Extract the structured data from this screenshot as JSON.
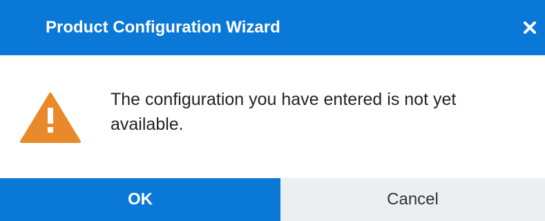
{
  "dialog": {
    "title": "Product Configuration Wizard",
    "message": "The configuration you have entered is not yet available.",
    "ok_label": "OK",
    "cancel_label": "Cancel",
    "icons": {
      "close": "close-icon",
      "warning": "warning-icon"
    },
    "colors": {
      "primary": "#0a78d7",
      "warning": "#e98a2a",
      "secondary_button": "#eceff2"
    }
  }
}
